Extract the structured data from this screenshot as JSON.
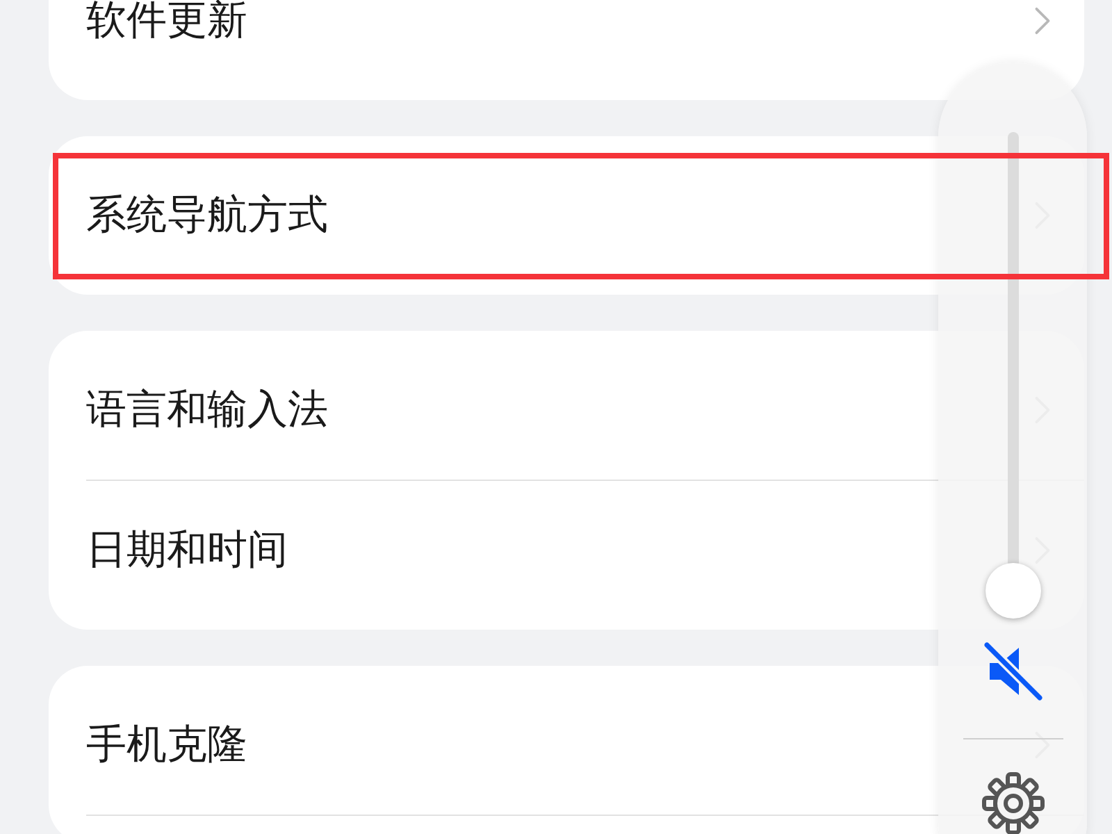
{
  "settings_groups": [
    {
      "items": [
        {
          "label": "软件更新",
          "highlighted": false
        }
      ]
    },
    {
      "items": [
        {
          "label": "系统导航方式",
          "highlighted": true
        }
      ]
    },
    {
      "items": [
        {
          "label": "语言和输入法",
          "highlighted": false
        },
        {
          "label": "日期和时间",
          "highlighted": false
        }
      ]
    },
    {
      "items": [
        {
          "label": "手机克隆",
          "highlighted": false
        }
      ]
    }
  ],
  "volume_panel": {
    "level": 0,
    "muted": true
  }
}
